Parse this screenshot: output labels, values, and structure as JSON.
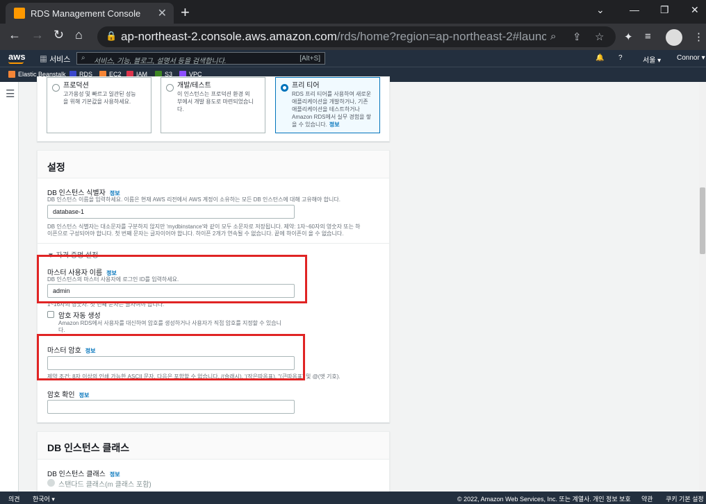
{
  "browser": {
    "tab_title": "RDS Management Console",
    "url_host": "ap-northeast-2.console.aws.amazon.com",
    "url_path": "/rds/home?region=ap-northeast-2#launch-dbinstanc..."
  },
  "aws_header": {
    "logo": "aws",
    "services_label": "서비스",
    "search_placeholder": "서비스, 기능, 블로그, 설명서 등을 검색합니다.",
    "search_shortcut": "[Alt+S]",
    "region": "서울 ▾",
    "user": "Connor ▾"
  },
  "favorites": [
    {
      "label": "Elastic Beanstalk",
      "color": "#f58536"
    },
    {
      "label": "RDS",
      "color": "#3b48cc"
    },
    {
      "label": "EC2",
      "color": "#f58536"
    },
    {
      "label": "IAM",
      "color": "#dd344c"
    },
    {
      "label": "S3",
      "color": "#3f8624"
    },
    {
      "label": "VPC",
      "color": "#8c4fff"
    }
  ],
  "templates": [
    {
      "title": "프로덕션",
      "desc": [
        "고가용성 및 빠르고 일관된 성능",
        "을 위해 기본값을 사용하세요."
      ],
      "selected": false
    },
    {
      "title": "개발/테스트",
      "desc": [
        "이 인스턴스는 프로덕션 환경 외",
        "부에서 개발 용도로 마련되었습니",
        "다."
      ],
      "selected": false
    },
    {
      "title": "프리 티어",
      "desc": [
        "RDS 프리 티어를 사용하여 새로운",
        "애플리케이션을 개발하거나, 기존",
        "애플리케이션을 테스트하거나",
        "Amazon RDS에서 실무 경험을 쌓",
        "을 수 있습니다."
      ],
      "info": "정보",
      "selected": true
    }
  ],
  "settings": {
    "title": "설정",
    "info": "정보",
    "db_identifier": {
      "label": "DB 인스턴스 식별자",
      "desc": "DB 인스턴스 이름을 입력하세요. 이름은 현재 AWS 리전에서 AWS 계정이 소유하는 모든 DB 인스턴스에 대해 고유해야 합니다.",
      "value": "database-1",
      "constraint_1": "DB 인스턴스 식별자는 대소문자를 구분하지 않지만 'mydbinstance'와 같이 모두 소문자로 저장됩니다. 제약: 1자~60자의 영숫자 또는 하",
      "constraint_2": "이픈으로 구성되어야 합니다. 첫 번째 문자는 글자이어야 합니다. 하이픈 2개가 연속될 수 없습니다. 끝에 하이픈이 올 수 없습니다."
    },
    "credentials_toggle": "▼ 자격 증명 설정",
    "master_username": {
      "label": "마스터 사용자 이름",
      "desc": "DB 인스턴스의 마스터 사용자에 로그인 ID를 입력하세요.",
      "value": "admin",
      "constraint": "1~16자의 영숫자. 첫 번째 문자는 글자여야 합니다."
    },
    "auto_password": {
      "label": "암호 자동 생성",
      "desc": "Amazon RDS에서 사용자를 대신하여 암호를 생성하거나 사용자가 직접 암호를 지정할 수 있습니",
      "desc2": "다."
    },
    "master_password": {
      "label": "마스터 암호",
      "constraint": "제약 조건: 8자 이상의 인쇄 가능한 ASCII 문자. 다음은 포함할 수 없습니다. /(슬래시), '(작은따옴표), \"(큰따옴표) 및 @(앳 기호)."
    },
    "confirm_password": {
      "label": "암호 확인"
    }
  },
  "instance_class": {
    "title": "DB 인스턴스 클래스",
    "label": "DB 인스턴스 클래스",
    "info": "정보",
    "option_standard": "스탠다드 클래스(m 클래스 포함)"
  },
  "footer": {
    "feedback": "의견",
    "language": "한국어 ▾",
    "copyright": "© 2022, Amazon Web Services, Inc. 또는 계열사.",
    "privacy": "개인 정보 보호",
    "terms": "약관",
    "cookies": "쿠키 기본 설정"
  }
}
